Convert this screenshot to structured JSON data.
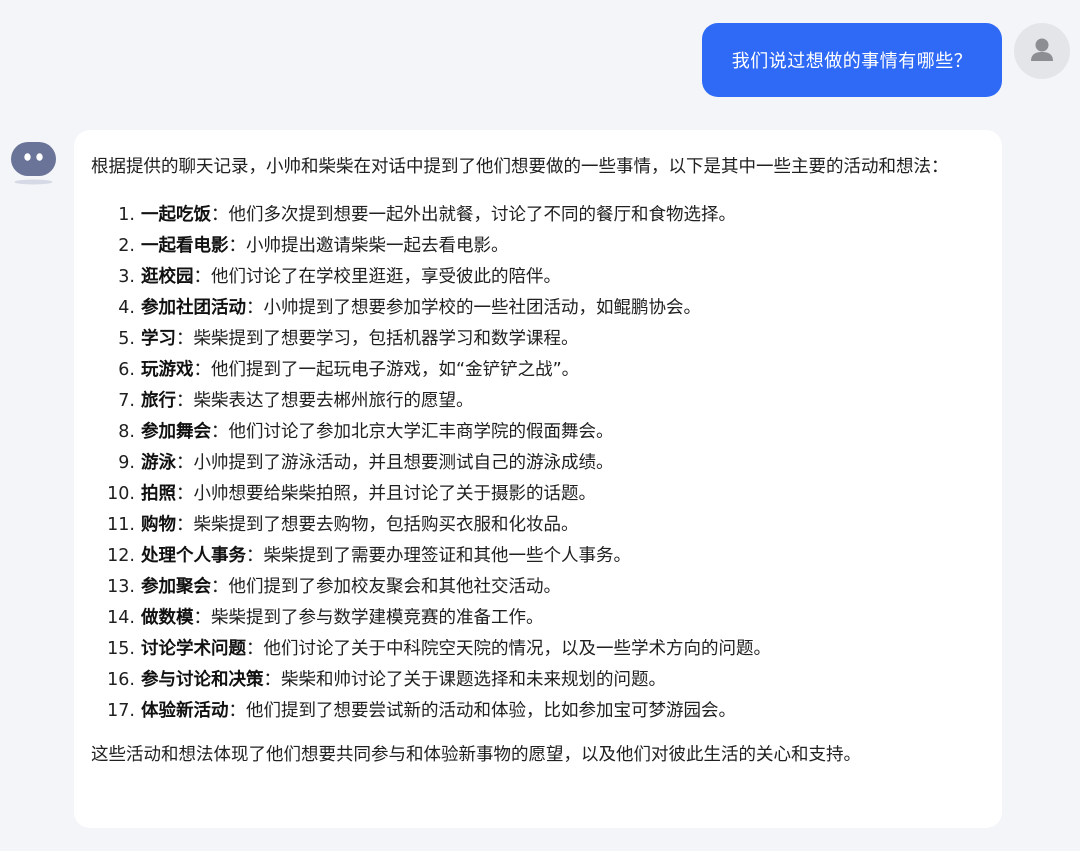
{
  "user_message": "我们说过想做的事情有哪些？",
  "assistant": {
    "intro": "根据提供的聊天记录，小帅和柴柴在对话中提到了他们想要做的一些事情，以下是其中一些主要的活动和想法：",
    "items": [
      {
        "num": "1.",
        "title": "一起吃饭",
        "desc": "：他们多次提到想要一起外出就餐，讨论了不同的餐厅和食物选择。"
      },
      {
        "num": "2.",
        "title": "一起看电影",
        "desc": "：小帅提出邀请柴柴一起去看电影。"
      },
      {
        "num": "3.",
        "title": "逛校园",
        "desc": "：他们讨论了在学校里逛逛，享受彼此的陪伴。"
      },
      {
        "num": "4.",
        "title": "参加社团活动",
        "desc": "：小帅提到了想要参加学校的一些社团活动，如鲲鹏协会。"
      },
      {
        "num": "5.",
        "title": "学习",
        "desc": "：柴柴提到了想要学习，包括机器学习和数学课程。"
      },
      {
        "num": "6.",
        "title": "玩游戏",
        "desc": "：他们提到了一起玩电子游戏，如“金铲铲之战”。"
      },
      {
        "num": "7.",
        "title": "旅行",
        "desc": "：柴柴表达了想要去郴州旅行的愿望。"
      },
      {
        "num": "8.",
        "title": "参加舞会",
        "desc": "：他们讨论了参加北京大学汇丰商学院的假面舞会。"
      },
      {
        "num": "9.",
        "title": "游泳",
        "desc": "：小帅提到了游泳活动，并且想要测试自己的游泳成绩。"
      },
      {
        "num": "10.",
        "title": "拍照",
        "desc": "：小帅想要给柴柴拍照，并且讨论了关于摄影的话题。"
      },
      {
        "num": "11.",
        "title": "购物",
        "desc": "：柴柴提到了想要去购物，包括购买衣服和化妆品。"
      },
      {
        "num": "12.",
        "title": "处理个人事务",
        "desc": "：柴柴提到了需要办理签证和其他一些个人事务。"
      },
      {
        "num": "13.",
        "title": "参加聚会",
        "desc": "：他们提到了参加校友聚会和其他社交活动。"
      },
      {
        "num": "14.",
        "title": "做数模",
        "desc": "：柴柴提到了参与数学建模竞赛的准备工作。"
      },
      {
        "num": "15.",
        "title": "讨论学术问题",
        "desc": "：他们讨论了关于中科院空天院的情况，以及一些学术方向的问题。"
      },
      {
        "num": "16.",
        "title": "参与讨论和决策",
        "desc": "：柴柴和帅讨论了关于课题选择和未来规划的问题。"
      },
      {
        "num": "17.",
        "title": "体验新活动",
        "desc": "：他们提到了想要尝试新的活动和体验，比如参加宝可梦游园会。"
      }
    ],
    "outro": "这些活动和想法体现了他们想要共同参与和体验新事物的愿望，以及他们对彼此生活的关心和支持。"
  },
  "icons": {
    "user_avatar": "user-avatar-icon",
    "bot_avatar": "bot-avatar-icon"
  },
  "colors": {
    "user_bubble": "#2f6af7",
    "background": "#f4f5f8",
    "card": "#ffffff"
  }
}
